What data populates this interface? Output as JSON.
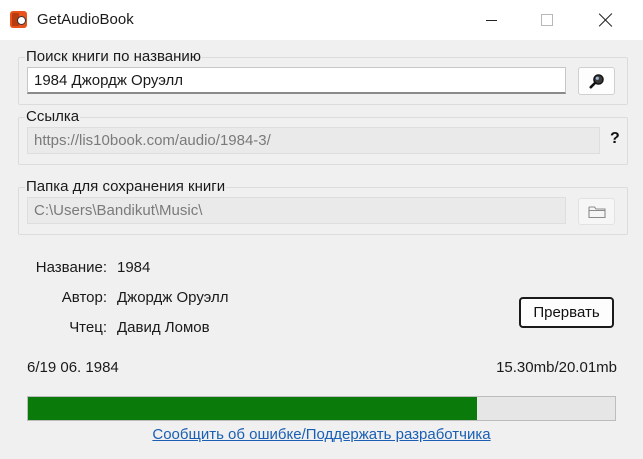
{
  "window": {
    "title": "GetAudioBook"
  },
  "search": {
    "label": "Поиск книги по названию",
    "value": "1984 Джордж Оруэлл",
    "button_icon": "search-magnifier-icon"
  },
  "link": {
    "label": "Ссылка",
    "value": "https://lis10book.com/audio/1984-3/",
    "help": "?"
  },
  "folder": {
    "label": "Папка для сохранения книги",
    "value": "C:\\Users\\Bandikut\\Music\\",
    "button_icon": "folder-icon"
  },
  "info": {
    "title_label": "Название:",
    "title_value": "1984",
    "author_label": "Автор:",
    "author_value": "Джордж Оруэлл",
    "reader_label": "Чтец:",
    "reader_value": "Давид Ломов"
  },
  "actions": {
    "stop_label": "Прервать"
  },
  "status": {
    "track": "6/19 06. 1984",
    "size": "15.30mb/20.01mb",
    "progress_fraction": 0.7646
  },
  "footer": {
    "link_text": "Сообщить об ошибке/Поддержать разработчика"
  },
  "colors": {
    "progress_fill": "#0a7a0a",
    "link": "#1a5fb4",
    "app_icon": "#e8521c"
  }
}
